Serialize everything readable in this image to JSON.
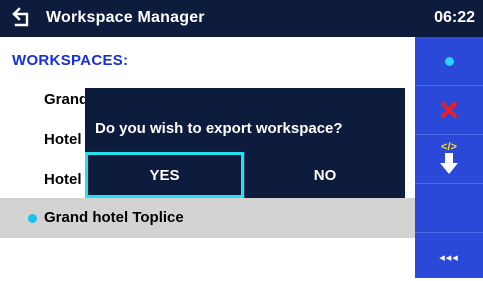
{
  "header": {
    "title": "Workspace Manager",
    "time": "06:22"
  },
  "section": {
    "title": "WORKSPACES:"
  },
  "workspaces": [
    {
      "label": "Grand hotel Union",
      "selected": false
    },
    {
      "label": "Hotel Slon",
      "selected": false
    },
    {
      "label": "Hotel Lev",
      "selected": false
    },
    {
      "label": "Grand hotel Toplice",
      "selected": true
    }
  ],
  "dialog": {
    "question": "Do you wish to export workspace?",
    "yes_label": "YES",
    "no_label": "NO"
  },
  "sidebar": {
    "buttons": [
      "select-dot-icon",
      "delete-icon",
      "export-icon",
      "empty",
      "back-menu-icon"
    ],
    "back_label": "◂◂◂"
  },
  "colors": {
    "header_bg": "#0d1b3d",
    "sidebar_bg": "#2a49d8",
    "accent_cyan": "#17c3f0",
    "section_blue": "#1530d8",
    "delete_red": "#e8202a",
    "selected_row_bg": "#d3d3d3"
  }
}
